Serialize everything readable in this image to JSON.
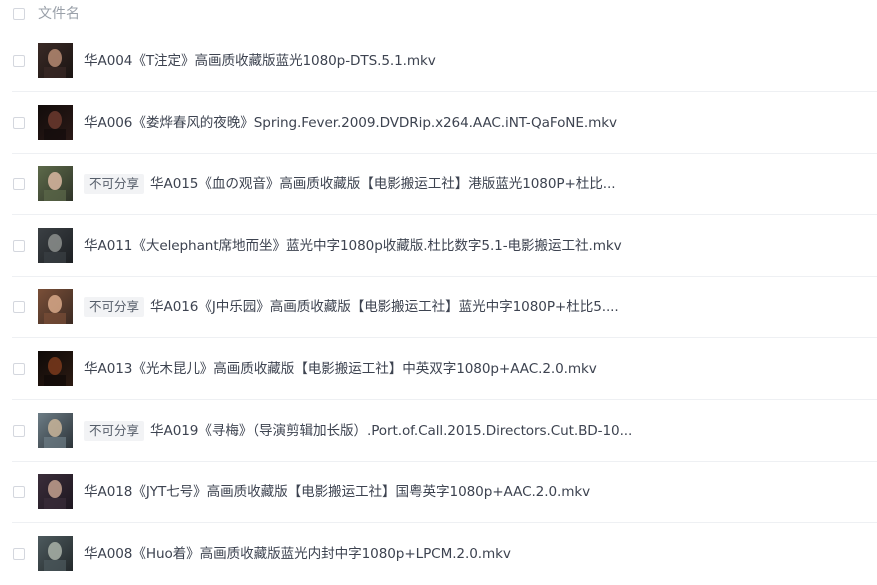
{
  "header": {
    "column_label": "文件名"
  },
  "files": [
    {
      "name": "华A004《T注定》高画质收藏版蓝光1080p-DTS.5.1.mkv",
      "badge": "",
      "thumb_colors": [
        "#3a2a26",
        "#b58a72",
        "#1a1412"
      ]
    },
    {
      "name": "华A006《娄烨春风的夜晚》Spring.Fever.2009.DVDRip.x264.AAC.iNT-QaFoNE.mkv",
      "badge": "",
      "thumb_colors": [
        "#120c0b",
        "#6b3a2e",
        "#2a1916"
      ]
    },
    {
      "name": "华A015《血の观音》高画质收藏版【电影搬运工社】港版蓝光1080P+杜比...",
      "badge": "不可分享",
      "thumb_colors": [
        "#5d6a4a",
        "#d9b7a1",
        "#2f3428"
      ]
    },
    {
      "name": "华A011《大elephant席地而坐》蓝光中字1080p收藏版.杜比数字5.1-电影搬运工社.mkv",
      "badge": "",
      "thumb_colors": [
        "#3b4044",
        "#8c8f8d",
        "#1d2023"
      ]
    },
    {
      "name": "华A016《J中乐园》高画质收藏版【电影搬运工社】蓝光中字1080P+杜比5....",
      "badge": "不可分享",
      "thumb_colors": [
        "#7a4f38",
        "#d8a98a",
        "#3b2a22"
      ]
    },
    {
      "name": "华A013《光木昆儿》高画质收藏版【电影搬运工社】中英双字1080p+AAC.2.0.mkv",
      "badge": "",
      "thumb_colors": [
        "#0f0a08",
        "#7a3a1c",
        "#2b1a12"
      ]
    },
    {
      "name": "华A019《寻梅》（导演剪辑加长版）.Port.of.Call.2015.Directors.Cut.BD-10...",
      "badge": "不可分享",
      "thumb_colors": [
        "#6d7d86",
        "#c9b59a",
        "#2c3338"
      ]
    },
    {
      "name": "华A018《JYT七号》高画质收藏版【电影搬运工社】国粤英字1080p+AAC.2.0.mkv",
      "badge": "",
      "thumb_colors": [
        "#3a2d3a",
        "#c2a08e",
        "#1e1720"
      ]
    },
    {
      "name": "华A008《Huo着》高画质收藏版蓝光内封中字1080p+LPCM.2.0.mkv",
      "badge": "",
      "thumb_colors": [
        "#4d5a5e",
        "#a9b2a8",
        "#23292b"
      ]
    }
  ]
}
